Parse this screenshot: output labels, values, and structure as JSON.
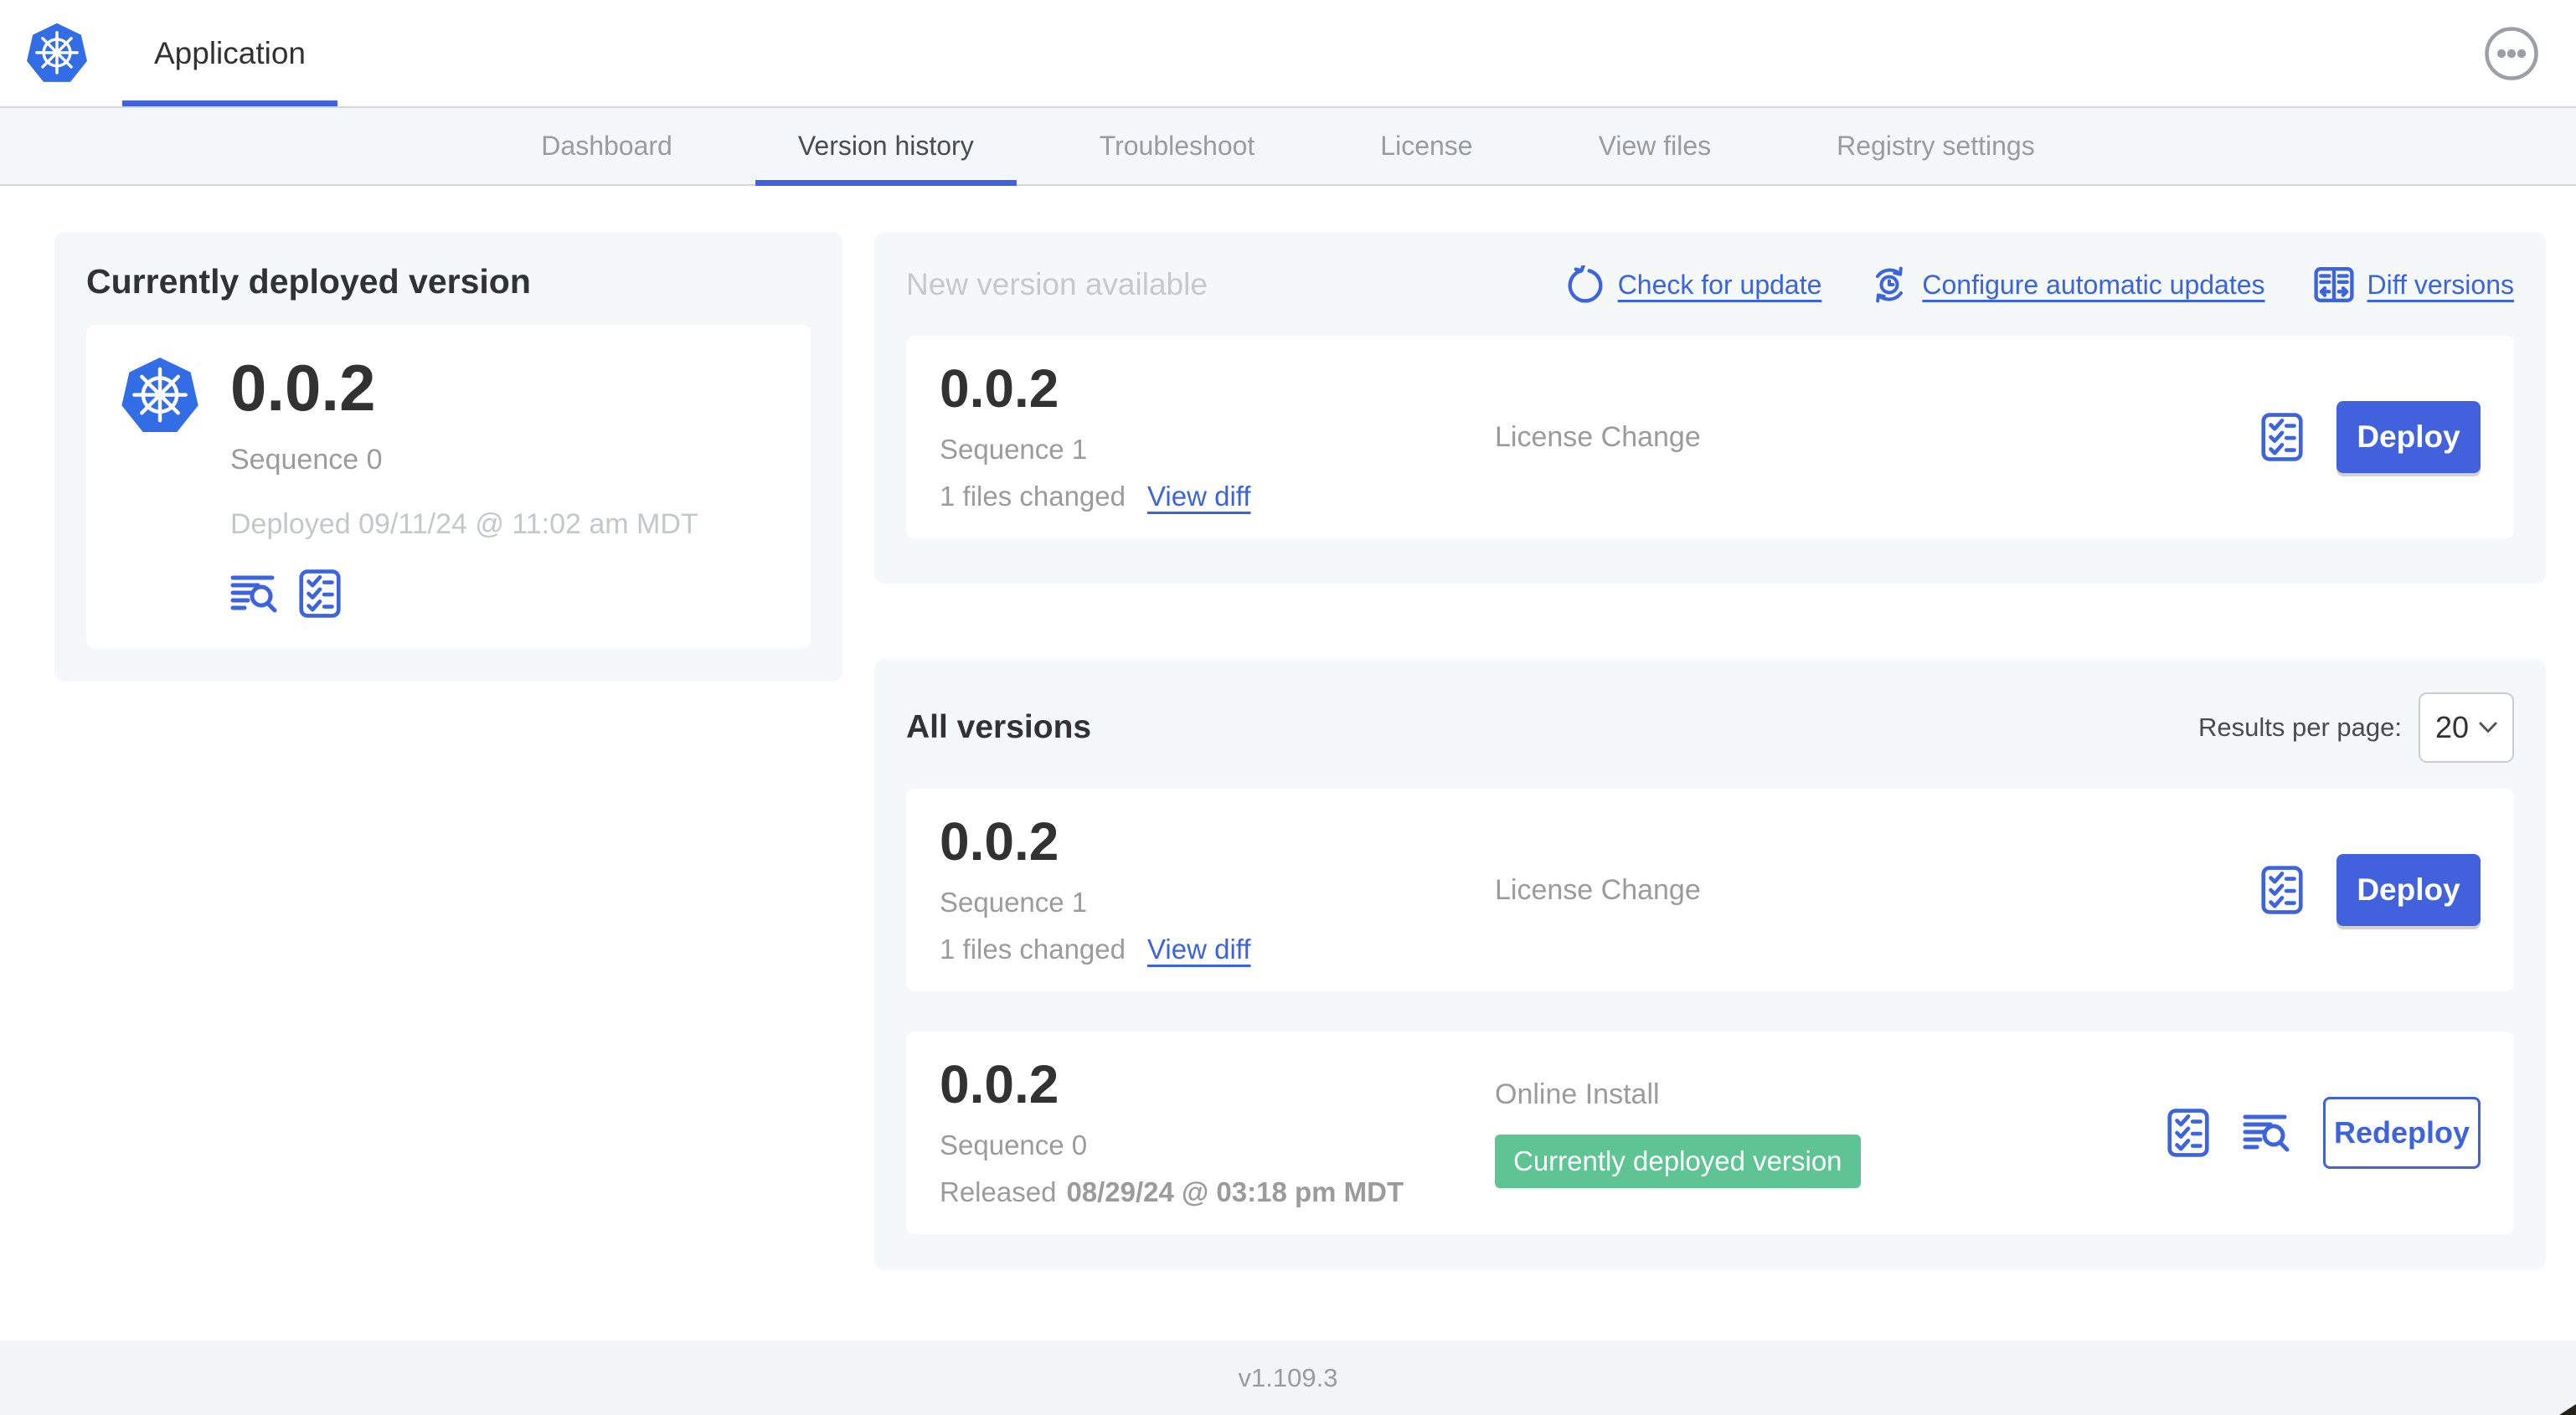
{
  "app": {
    "title": "Application"
  },
  "nav": {
    "tabs": [
      {
        "label": "Dashboard",
        "active": false
      },
      {
        "label": "Version history",
        "active": true
      },
      {
        "label": "Troubleshoot",
        "active": false
      },
      {
        "label": "License",
        "active": false
      },
      {
        "label": "View files",
        "active": false
      },
      {
        "label": "Registry settings",
        "active": false
      }
    ]
  },
  "current_version": {
    "title": "Currently deployed version",
    "version": "0.0.2",
    "sequence": "Sequence 0",
    "deployed": "Deployed 09/11/24 @ 11:02 am MDT",
    "icons": [
      "logs-icon",
      "checklist-icon"
    ]
  },
  "new_version": {
    "title": "New version available",
    "actions": [
      {
        "label": "Check for update",
        "icon": "refresh-icon"
      },
      {
        "label": "Configure automatic updates",
        "icon": "auto-update-icon"
      },
      {
        "label": "Diff versions",
        "icon": "diff-icon"
      }
    ],
    "row": {
      "version": "0.0.2",
      "sequence": "Sequence 1",
      "files_changed": "1 files changed",
      "view_diff_label": "View diff",
      "source": "License Change",
      "action_label": "Deploy"
    }
  },
  "all_versions": {
    "title": "All versions",
    "results_per_page_label": "Results per page:",
    "results_per_page_value": "20",
    "rows": [
      {
        "version": "0.0.2",
        "sequence": "Sequence 1",
        "files_changed": "1 files changed",
        "view_diff_label": "View diff",
        "source": "License Change",
        "action_label": "Deploy"
      },
      {
        "version": "0.0.2",
        "sequence": "Sequence 0",
        "released_prefix": "Released",
        "released_date": "08/29/24 @ 03:18 pm MDT",
        "source": "Online Install",
        "badge": "Currently deployed version",
        "action_label": "Redeploy"
      }
    ]
  },
  "footer": {
    "version": "v1.109.3"
  },
  "colors": {
    "link_blue": "#3b63dd",
    "button_blue": "#4262dd",
    "badge_green": "#5fc494",
    "heading_dark": "#323232",
    "muted_gray": "#9b9b9b",
    "faint_gray": "#c3c7cb",
    "panel_gray": "#f5f8f9",
    "kubernetes_blue": "#326de6"
  }
}
